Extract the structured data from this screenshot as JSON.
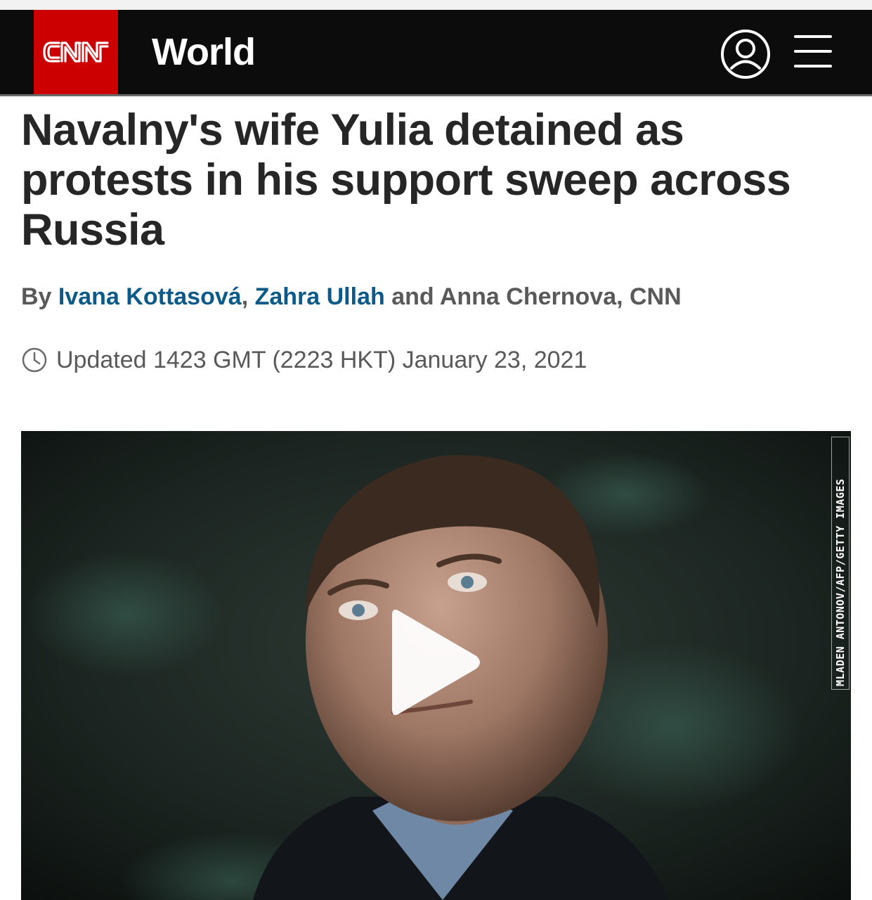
{
  "header": {
    "logo_text": "CNN",
    "section": "World",
    "brand_color": "#cc0000",
    "user_icon": "user-account-icon",
    "menu_icon": "hamburger-menu-icon"
  },
  "article": {
    "headline": "Navalny's wife Yulia detained as protests in his support sweep across Russia",
    "byline": {
      "prefix": "By ",
      "author1": "Ivana Kottasová",
      "separator": ", ",
      "author2": "Zahra Ullah",
      "suffix": " and Anna Chernova, CNN"
    },
    "updated": "Updated 1423 GMT (2223 HKT) January 23, 2021",
    "clock_icon": "clock-icon"
  },
  "media": {
    "credit": "MLADEN ANTONOV/AFP/GETTY IMAGES",
    "play_icon": "play-icon"
  }
}
